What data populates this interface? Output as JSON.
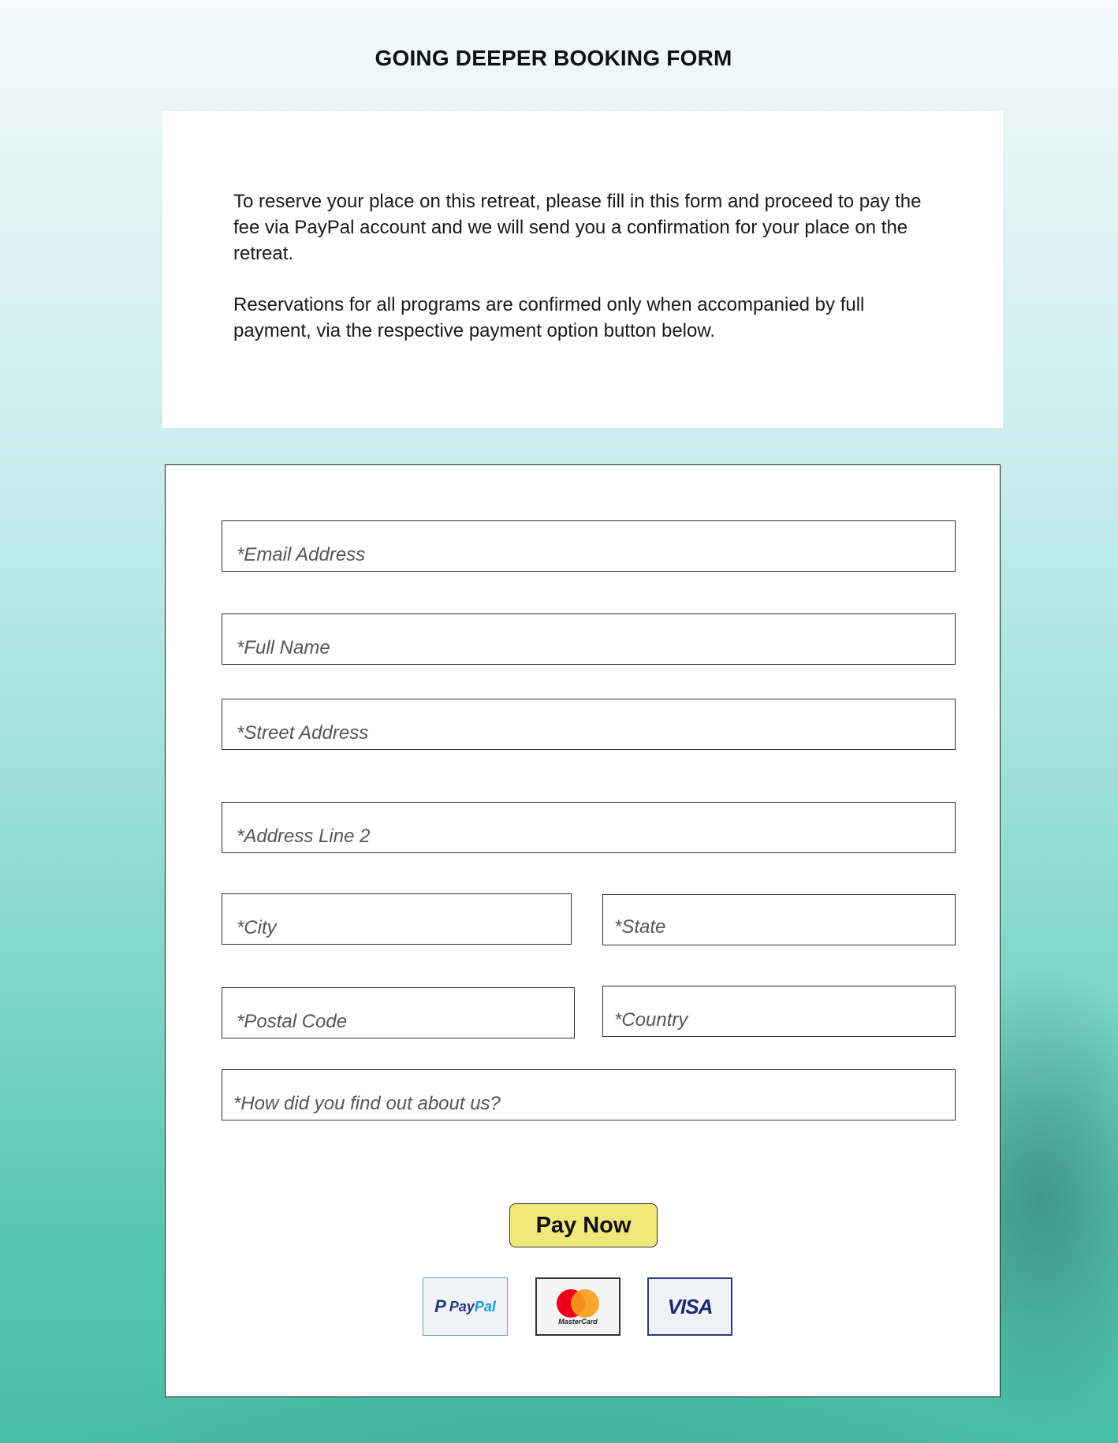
{
  "header": {
    "title": "GOING DEEPER BOOKING  FORM"
  },
  "intro": {
    "paragraph1": "To reserve your place on this retreat, please fill in this form and proceed to pay the fee via PayPal account and we will send you a confirmation for your place on the retreat.",
    "paragraph2": "Reservations for all programs are confirmed only when accompanied by full payment, via the respective payment option button below."
  },
  "form": {
    "email": {
      "placeholder": "*Email Address",
      "value": ""
    },
    "full_name": {
      "placeholder": "*Full Name",
      "value": ""
    },
    "street_address": {
      "placeholder": "*Street Address",
      "value": ""
    },
    "address_line2": {
      "placeholder": "*Address Line 2",
      "value": ""
    },
    "city": {
      "placeholder": "*City",
      "value": ""
    },
    "state": {
      "placeholder": "*State",
      "value": ""
    },
    "postal_code": {
      "placeholder": "*Postal Code",
      "value": ""
    },
    "country": {
      "placeholder": "*Country",
      "value": ""
    },
    "referral": {
      "placeholder": "*How did you find out about us?",
      "value": ""
    },
    "pay_button_label": "Pay Now"
  },
  "payment_methods": {
    "paypal": {
      "p": "P",
      "pay": "Pay",
      "pal": "Pal",
      "icon": "paypal-logo"
    },
    "mastercard": {
      "label": "MasterCard",
      "icon": "mastercard-logo"
    },
    "visa": {
      "label": "VISA",
      "icon": "visa-logo"
    }
  },
  "colors": {
    "pay_button": "#f1e87a",
    "paypal_dark": "#253b80",
    "paypal_light": "#179bd7",
    "mastercard_red": "#eb001b",
    "mastercard_yellow": "#f79e1b",
    "visa_blue": "#1a2a6c"
  }
}
